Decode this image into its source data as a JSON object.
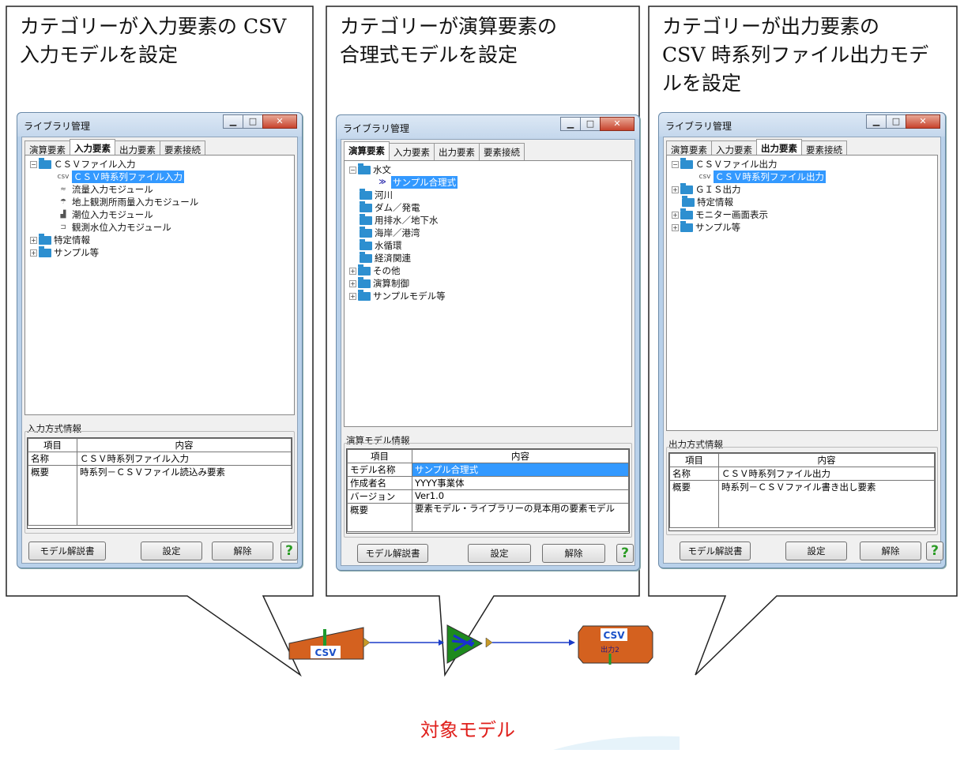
{
  "captions": [
    "カテゴリーが入力要素の CSV\n入力モデルを設定",
    "カテゴリーが演算要素の\n合理式モデルを設定",
    "カテゴリーが出力要素の\nCSV 時系列ファイル出力モデ\nルを設定"
  ],
  "window_title": "ライブラリ管理",
  "tabs": [
    "演算要素",
    "入力要素",
    "出力要素",
    "要素接続"
  ],
  "buttons": {
    "manual": "モデル解説書",
    "set": "設定",
    "release": "解除",
    "help": "?"
  },
  "info_headers": {
    "item": "項目",
    "content": "内容"
  },
  "left": {
    "tree": {
      "root": "ＣＳＶファイル入力",
      "children": [
        "ＣＳＶ時系列ファイル入力",
        "流量入力モジュール",
        "地上観測所雨量入力モジュール",
        "潮位入力モジュール",
        "観測水位入力モジュール"
      ],
      "others": [
        "特定情報",
        "サンプル等"
      ]
    },
    "group": "入力方式情報",
    "rows": [
      {
        "item": "名称",
        "value": "ＣＳＶ時系列ファイル入力"
      },
      {
        "item": "概要",
        "value": "時系列－ＣＳＶファイル読込み要素"
      }
    ]
  },
  "middle": {
    "tree": {
      "root": "水文",
      "child": "サンプル合理式",
      "folders": [
        "河川",
        "ダム／発電",
        "用排水／地下水",
        "海岸／港湾",
        "水循環",
        "経済関連"
      ],
      "expandable": [
        "その他",
        "演算制御",
        "サンプルモデル等"
      ]
    },
    "group": "演算モデル情報",
    "rows": [
      {
        "item": "モデル名称",
        "value": "サンプル合理式"
      },
      {
        "item": "作成者名",
        "value": "YYYY事業体"
      },
      {
        "item": "バージョン",
        "value": "Ver1.0"
      },
      {
        "item": "概要",
        "value": "要素モデル・ライブラリーの見本用の要素モデル"
      }
    ]
  },
  "right": {
    "tree": {
      "root": "ＣＳＶファイル出力",
      "child": "ＣＳＶ時系列ファイル出力",
      "items": [
        "ＧＩＳ出力",
        "特定情報",
        "モニター画面表示",
        "サンプル等"
      ]
    },
    "group": "出力方式情報",
    "rows": [
      {
        "item": "名称",
        "value": "ＣＳＶ時系列ファイル出力"
      },
      {
        "item": "概要",
        "value": "時系列－ＣＳＶファイル書き出し要素"
      }
    ]
  },
  "flow": {
    "in_label": "CSV",
    "out_label": "CSV",
    "out_sub": "出力2",
    "target": "対象モデル"
  },
  "colors": {
    "selection": "#3399ff",
    "node_orange": "#d4611f",
    "node_green": "#1e8a1e",
    "target_red": "#e0201c"
  }
}
